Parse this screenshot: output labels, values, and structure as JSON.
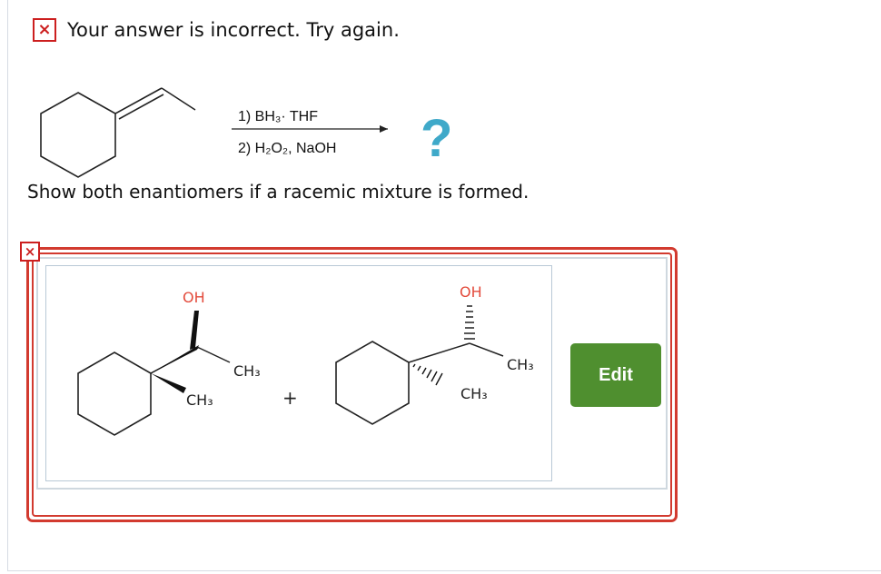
{
  "feedback": {
    "status_symbol": "×",
    "message": "Your answer is incorrect.  Try again."
  },
  "reaction": {
    "reagent_step1": "1) BH₃· THF",
    "reagent_step2": "2) H₂O₂, NaOH",
    "product_placeholder": "?"
  },
  "instruction": "Show both enantiomers if a racemic mixture is formed.",
  "answer": {
    "status_symbol": "×",
    "oh_label": "OH",
    "ch3_label": "CH₃",
    "plus_sign": "+",
    "edit_label": "Edit"
  },
  "colors": {
    "error_red": "#cc1f1f",
    "answer_border": "#d23a2f",
    "edit_button": "#4f8f2f",
    "question_mark": "#3fa9c9",
    "oh_red": "#e34b3c"
  },
  "icons": {
    "incorrect": "x-mark-icon",
    "unknown_product": "question-mark-icon"
  }
}
